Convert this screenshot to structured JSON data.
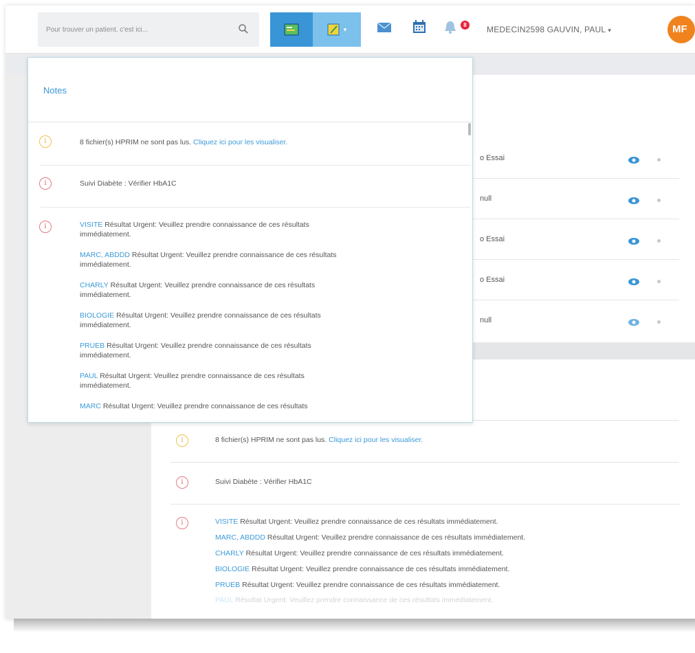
{
  "navbar": {
    "search_placeholder": "Pour trouver un patient, c'est ici...",
    "badge_count": "8",
    "user_name": "MEDECIN2598 GAUVIN, PAUL",
    "user_caret": "▾",
    "avatar_initials": "MF",
    "colors": {
      "primary": "#3a95d6",
      "primary_light": "#7cc0ec",
      "badge": "#e3253b",
      "avatar": "#f0831e"
    }
  },
  "background_rows": [
    {
      "text": "o Essai"
    },
    {
      "text": "null"
    },
    {
      "text": "o Essai"
    },
    {
      "text": "o Essai"
    },
    {
      "text": "null"
    }
  ],
  "notes_dropdown": {
    "title": "Notes",
    "hprim": {
      "text": "8 fichier(s) HPRIM ne sont pas lus.",
      "link": "Cliquez ici pour les visualiser."
    },
    "diabete": {
      "text": "Suivi Diabète : Vérifier HbA1C"
    },
    "results": [
      {
        "patient": "VISITE",
        "line1": "Résultat Urgent: Veuillez prendre connaissance de ces résultats",
        "line2": "immédiatement."
      },
      {
        "patient": "MARC, ABDDD",
        "line1": "Résultat Urgent: Veuillez prendre connaissance de ces résultats",
        "line2": "immédiatement."
      },
      {
        "patient": "CHARLY",
        "line1": "Résultat Urgent: Veuillez prendre connaissance de ces résultats",
        "line2": "immédiatement."
      },
      {
        "patient": "BIOLOGIE",
        "line1": "Résultat Urgent: Veuillez prendre connaissance de ces résultats",
        "line2": "immédiatement."
      },
      {
        "patient": "PRUEB",
        "line1": "Résultat Urgent: Veuillez prendre connaissance de ces résultats",
        "line2": "immédiatement."
      },
      {
        "patient": "PAUL",
        "line1": "Résultat Urgent: Veuillez prendre connaissance de ces résultats",
        "line2": "immédiatement."
      },
      {
        "patient": "MARC",
        "line1": "Résultat Urgent: Veuillez prendre connaissance de ces résultats",
        "line2": ""
      }
    ]
  },
  "background_notes": {
    "hprim_text": "8 fichier(s) HPRIM ne sont pas lus.",
    "hprim_link": "Cliquez ici pour les visualiser.",
    "diabete_text": "Suivi Diabète : Vérifier HbA1C",
    "results": [
      {
        "patient": "VISITE",
        "text": "Résultat Urgent: Veuillez prendre connaissance de ces résultats immédiatement."
      },
      {
        "patient": "MARC, ABDDD",
        "text": "Résultat Urgent: Veuillez prendre connaissance de ces résultats immédiatement."
      },
      {
        "patient": "CHARLY",
        "text": "Résultat Urgent: Veuillez prendre connaissance de ces résultats immédiatement."
      },
      {
        "patient": "BIOLOGIE",
        "text": "Résultat Urgent: Veuillez prendre connaissance de ces résultats immédiatement."
      },
      {
        "patient": "PRUEB",
        "text": "Résultat Urgent: Veuillez prendre connaissance de ces résultats immédiatement."
      },
      {
        "patient": "PAUL",
        "text": "Résultat Urgent: Veuillez prendre connaissance de ces résultats immédiatement."
      }
    ]
  }
}
